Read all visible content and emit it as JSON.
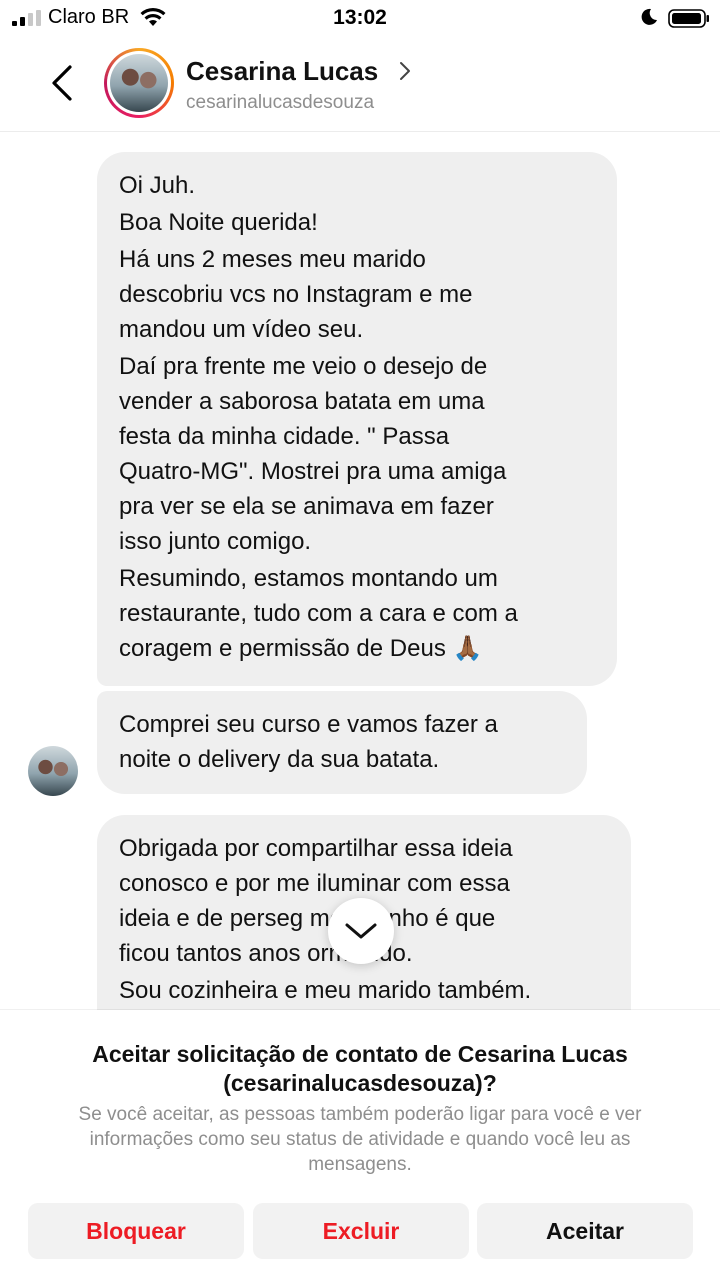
{
  "status_bar": {
    "carrier": "Claro BR",
    "time": "13:02",
    "icons": [
      "signal-icon",
      "wifi-icon",
      "do-not-disturb-moon-icon",
      "battery-icon"
    ]
  },
  "header": {
    "back_icon": "chevron-left-icon",
    "name": "Cesarina Lucas",
    "handle": "cesarinalucasdesouza",
    "name_chevron_icon": "chevron-right-icon"
  },
  "messages": [
    {
      "paragraphs": [
        "Oi Juh.",
        "Boa Noite querida!",
        "Há uns 2 meses meu marido\ndescobriu vcs no Instagram e me\nmandou um vídeo  seu.",
        "Daí pra frente me veio o desejo de\nvender a saborosa batata em uma\nfesta da minha cidade. \" Passa\nQuatro-MG\". Mostrei pra uma amiga\npra ver se ela se animava em fazer\nisso junto comigo.",
        "Resumindo, estamos montando um\nrestaurante, tudo com a cara e com a\ncoragem e permissão de Deus 🙏🏾"
      ]
    },
    {
      "paragraphs": [
        "Comprei seu curso e vamos fazer a\nnoite o delivery da sua batata."
      ]
    },
    {
      "paragraphs": [
        "Obrigada por compartilhar essa ideia\nconosco e por me iluminar com essa\nideia e de perseg     meu sonho é que\nficou tantos anos   ormecido.",
        "Sou cozinheira e meu marido também."
      ]
    }
  ],
  "scroll_button_icon": "chevron-down-icon",
  "request": {
    "title": "Aceitar solicitação de contato de Cesarina Lucas (cesarinalucasdesouza)?",
    "body": "Se você aceitar, as pessoas também poderão ligar para você e ver informações como seu status de atividade e quando você leu as mensagens.",
    "block_label": "Bloquear",
    "delete_label": "Excluir",
    "accept_label": "Aceitar",
    "danger_color": "#ed1c24"
  }
}
